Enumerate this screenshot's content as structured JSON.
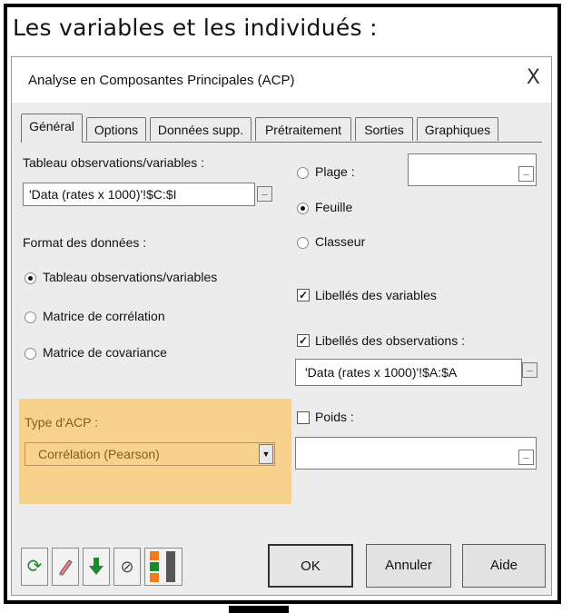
{
  "heading": "Les variables et les individués :",
  "dialog": {
    "title": "Analyse en Composantes Principales (ACP)",
    "close": "X",
    "tabs": [
      {
        "label": "Général",
        "active": true
      },
      {
        "label": "Options"
      },
      {
        "label": "Données supp."
      },
      {
        "label": "Prétraitement"
      },
      {
        "label": "Sorties"
      },
      {
        "label": "Graphiques"
      }
    ],
    "left": {
      "table_label": "Tableau observations/variables :",
      "table_value": "'Data (rates x 1000)'!$C:$I",
      "format_label": "Format des données :",
      "formats": [
        {
          "label": "Tableau observations/variables",
          "selected": true
        },
        {
          "label": "Matrice de corrélation",
          "selected": false
        },
        {
          "label": "Matrice de covariance",
          "selected": false
        }
      ],
      "type_label": "Type d'ACP :",
      "type_value": "Corrélation (Pearson)"
    },
    "right": {
      "ranges": [
        {
          "label": "Plage :",
          "selected": false
        },
        {
          "label": "Feuille",
          "selected": true
        },
        {
          "label": "Classeur",
          "selected": false
        }
      ],
      "var_labels": {
        "label": "Libellés des variables",
        "checked": true
      },
      "obs_labels": {
        "label": "Libellés des observations :",
        "checked": true
      },
      "obs_value": "'Data (rates x 1000)'!$A:$A",
      "weights": {
        "label": "Poids :",
        "checked": false
      },
      "weights_value": ""
    },
    "buttons": {
      "ok": "OK",
      "cancel": "Annuler",
      "help": "Aide"
    },
    "icons": [
      "reset-icon",
      "eraser-icon",
      "download-arrow-icon",
      "clear-icon",
      "orange-green-bars-icon"
    ],
    "colors": {
      "highlight": "#f7d28c",
      "type_text": "#8a5a1a",
      "green": "#1e8a2e",
      "orange": "#f07b1a"
    }
  }
}
